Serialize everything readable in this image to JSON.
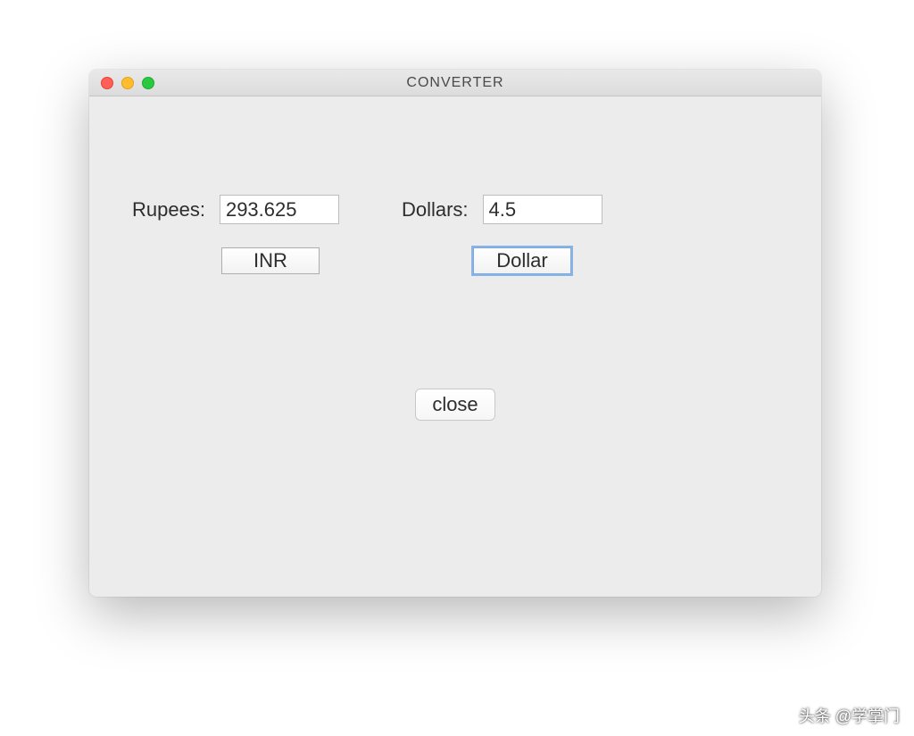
{
  "window": {
    "title": "CONVERTER"
  },
  "form": {
    "rupees_label": "Rupees:",
    "rupees_value": "293.625",
    "dollars_label": "Dollars:",
    "dollars_value": "4.5",
    "inr_button": "INR",
    "dollar_button": "Dollar",
    "close_button": "close"
  },
  "watermark": "头条 @学掌门"
}
